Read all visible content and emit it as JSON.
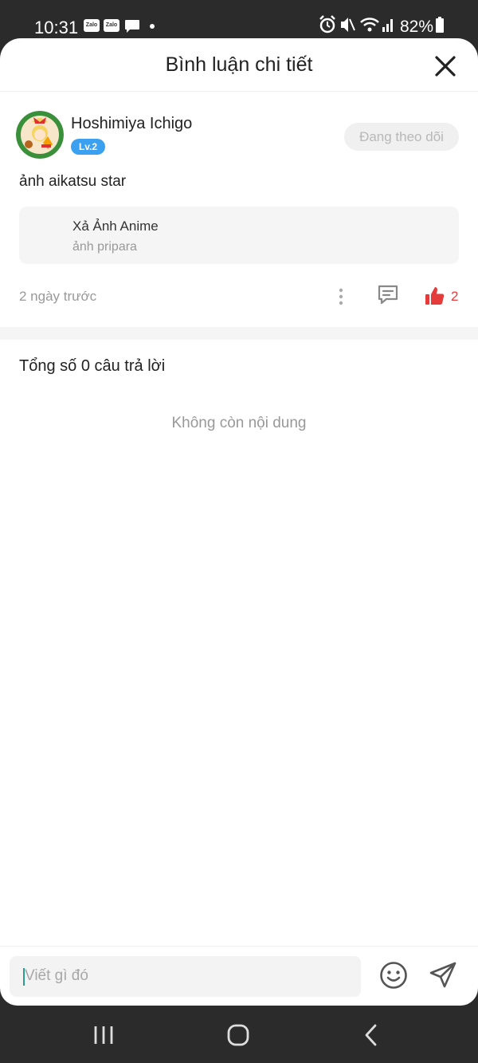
{
  "status": {
    "time": "10:31",
    "battery": "82%",
    "zalo_badge": "Zalo"
  },
  "header": {
    "title": "Bình luận chi tiết"
  },
  "comment": {
    "username": "Hoshimiya Ichigo",
    "level": "Lv.2",
    "follow_label": "Đang theo dõi",
    "text": "ảnh aikatsu star",
    "post": {
      "title": "Xả Ảnh Anime",
      "subtitle": "ảnh pripara"
    },
    "time_ago": "2 ngày trước",
    "like_count": "2"
  },
  "replies": {
    "total_label": "Tổng số 0 câu trả lời",
    "empty_label": "Không còn nội dung"
  },
  "composer": {
    "placeholder": "Viết gì đó"
  },
  "colors": {
    "accent_like": "#e63b3b",
    "level_badge": "#3ca0f0",
    "caret": "#2a9d8f"
  },
  "icons": [
    "zalo-icon",
    "message-icon",
    "alarm-icon",
    "mute-icon",
    "wifi-icon",
    "signal-icon",
    "battery-icon",
    "close-icon",
    "more-icon",
    "reply-icon",
    "like-icon",
    "emoji-icon",
    "send-icon",
    "recent-apps-icon",
    "home-icon",
    "back-icon"
  ]
}
